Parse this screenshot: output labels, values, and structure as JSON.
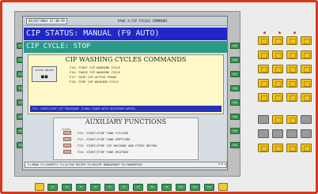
{
  "topbar": {
    "datetime": "04/02/2004  12:38:49",
    "page_title": "PAGE 3:CIP CYCLES COMMANDS"
  },
  "status": {
    "line1": "CIP STATUS: MANUAL (F9 AUTO)",
    "line2": "CIP CYCLE: STOP"
  },
  "wash": {
    "title": "CIP WASHING CYCLES COMMANDS",
    "active_recipe_label": "ACTIVE RECIPE",
    "active_recipe_value": "■■",
    "commands": [
      "F15: START CIP WASHING CYCLE",
      "F16: PAUSE CIP WASHING CYCLE",
      "F17: SKIP CIP ACTIVE PHASE",
      "F18: STOP CIP WASHING CYCLE"
    ],
    "alert": "F31: START/STOP CIP PROCEDURE (FINAL RINSE WITH RECOVERED WATER)"
  },
  "aux": {
    "title": "AUXILIARY FUNCTIONS",
    "status_label": "STATUS",
    "rows": [
      "F21: START/STOP TANK FILLING",
      "F22: START/STOP TANK EMPTYING",
      "F23: START/STOP CIP MACHINE AND PIPES DRYING",
      "F24: START/STOP TANK HEATING"
    ]
  },
  "footer": {
    "text": "F1:MENU F2:SYNOPTIC F4:ACTIVE RECIPE F5:RECIPE MANAGEMENT F6:PARAMETERS",
    "right": "E.B.A."
  },
  "left_fkeys": [
    "F17",
    "F18",
    "F19",
    "F20",
    "F21",
    "F22",
    "F23",
    "F24"
  ],
  "right_fkeys": [
    "F25",
    "F26",
    "F27",
    "F28",
    "F29",
    "F30",
    "F31",
    "F32"
  ],
  "bottom_fkeys": [
    "F1",
    "F2",
    "F3",
    "F4",
    "F5",
    "F6",
    "F7",
    "F8",
    "F9",
    "F10",
    "F11",
    "F12"
  ],
  "colors": {
    "frame": "#d43a1c",
    "status_bar": "#1f27c8",
    "cycle_bar": "#2a9a88",
    "fkey": "#3e9a55",
    "keypad_yellow": "#f1c21b",
    "keypad_grey": "#9a9a9a"
  }
}
